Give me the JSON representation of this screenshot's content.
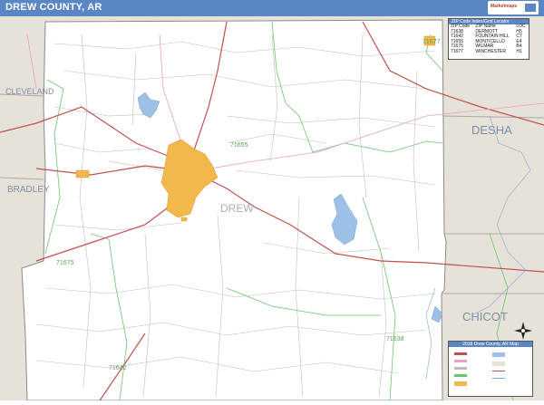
{
  "header": {
    "title": "DREW COUNTY, AR",
    "logo_text": "Marketmaps"
  },
  "map": {
    "county_label": "DREW",
    "neighbors": [
      "CLEVELAND",
      "BRADLEY",
      "DESHA",
      "CHICOT"
    ],
    "zip_labels": [
      "71655",
      "71675",
      "71638",
      "71642",
      "71677"
    ]
  },
  "zip_table": {
    "title": "ZIP Code Index/Grid Locator",
    "headers": [
      "ZIP Code",
      "ZIP Name",
      "LOC"
    ],
    "rows": [
      [
        "71638",
        "DERMOTT",
        "H5"
      ],
      [
        "71642",
        "FOUNTAIN HILL",
        "C7"
      ],
      [
        "71655",
        "MONTICELLO",
        "E4"
      ],
      [
        "71675",
        "WILMAR",
        "B4"
      ],
      [
        "71677",
        "WINCHESTER",
        "H1"
      ]
    ]
  },
  "legend": {
    "title": "2018 Drew County, AR Map"
  },
  "colors": {
    "title_bar": "#5a86c6",
    "neighbor_fill": "#e6e2d9",
    "city_fill": "#f2b84b",
    "water": "#9cc0e6",
    "highway": "#c0504d",
    "zip_boundary": "#6ec46e",
    "roads": "#b8b8b8"
  }
}
